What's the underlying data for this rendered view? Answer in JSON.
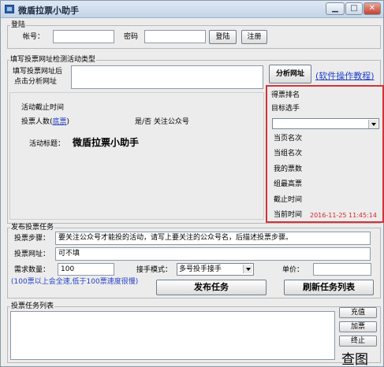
{
  "window": {
    "title": "微盾拉票小助手",
    "minimize_glyph": "▁",
    "maximize_glyph": "□",
    "close_glyph": "✕",
    "icon": "app-window-icon"
  },
  "login": {
    "legend": "登陆",
    "account_label": "帐号：",
    "account_value": "",
    "password_label": "密码",
    "password_value": "",
    "login_button": "登陆",
    "register_button": "注册"
  },
  "url_section": {
    "legend": "填写投票网址检测活动类型",
    "hint_line1": "填写投票网址后",
    "hint_line2": "点击分析网址",
    "url_value": "",
    "analyze_button": "分析网址",
    "tutorial_link": "(软件操作教程)"
  },
  "activity": {
    "deadline_label": "活动截止时间",
    "voters_label": "投票人数(",
    "voters_link": "底票",
    "voters_close": ")",
    "follow_label": "是/否 关注公众号",
    "title_label": "活动标题：",
    "title_value": "微盾拉票小助手"
  },
  "ranking": {
    "legend": "得票排名",
    "target_label": "目标选手",
    "selected": "",
    "rows": [
      {
        "label": "当页名次",
        "value": ""
      },
      {
        "label": "当组名次",
        "value": ""
      },
      {
        "label": "我的票数",
        "value": ""
      },
      {
        "label": "组最高票",
        "value": ""
      },
      {
        "label": "截止时间",
        "value": ""
      },
      {
        "label": "当前时间",
        "value": "2016-11-25 11:45:14"
      }
    ],
    "time_color": "#d6262b"
  },
  "publish": {
    "legend": "发布投票任务",
    "steps_label": "投票步骤：",
    "steps_value": "要关注公众号才能投的活动，请写上要关注的公众号名，后描述投票步骤。",
    "url_label": "投票网址：",
    "url_value": "可不填",
    "quantity_label": "需求数量：",
    "quantity_value": "100",
    "mode_label": "接手模式：",
    "mode_value": "多号投手接手",
    "price_label": "单价：",
    "price_value": "",
    "note": "(100票以上会全速,低于100票速度很慢)",
    "publish_button": "发布任务",
    "refresh_button": "刷新任务列表"
  },
  "task_list": {
    "legend": "投票任务列表",
    "buttons": [
      "充值",
      "加票",
      "终止"
    ]
  },
  "caption": "查图",
  "colors": {
    "panel_border": "#d23338",
    "link": "#2440c8"
  }
}
